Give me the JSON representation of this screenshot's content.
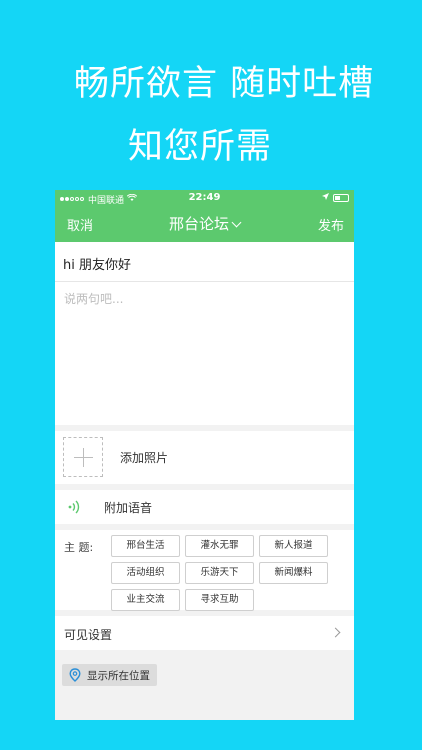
{
  "promo": {
    "line1": "畅所欲言 随时吐槽",
    "line2": "知您所需"
  },
  "status_bar": {
    "carrier": "中国联通",
    "time": "22:49"
  },
  "nav": {
    "cancel": "取消",
    "title": "邢台论坛",
    "publish": "发布"
  },
  "post": {
    "title_value": "hi 朋友你好",
    "body_placeholder": "说两句吧..."
  },
  "photo": {
    "label": "添加照片"
  },
  "voice": {
    "label": "附加语音"
  },
  "topic": {
    "label": "主  题:",
    "tags": [
      "邢台生活",
      "灌水无罪",
      "新人报道",
      "活动组织",
      "乐游天下",
      "新闻爆料",
      "业主交流",
      "寻求互助"
    ]
  },
  "visibility": {
    "label": "可见设置"
  },
  "location": {
    "label": "显示所在位置"
  },
  "colors": {
    "background": "#14d6f6",
    "accent": "#5cc96e"
  }
}
